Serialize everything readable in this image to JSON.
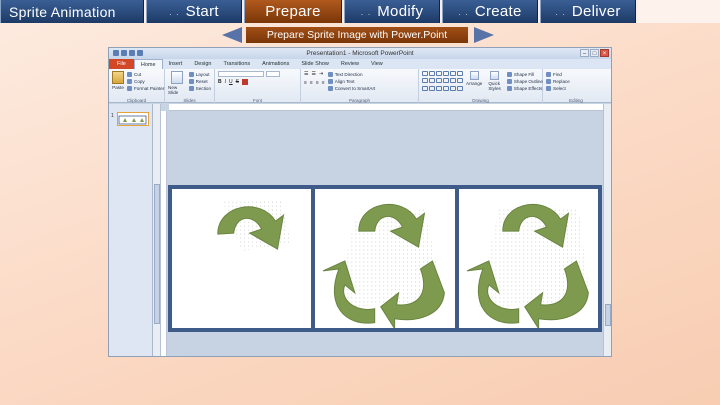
{
  "nav": {
    "brand": "Sprite Animation",
    "dots": ". .",
    "tabs": [
      {
        "label": "Start",
        "active": false
      },
      {
        "label": "Prepare",
        "active": true
      },
      {
        "label": "Modify",
        "active": false
      },
      {
        "label": "Create",
        "active": false
      },
      {
        "label": "Deliver",
        "active": false
      }
    ]
  },
  "substep": {
    "label": "Prepare Sprite Image with Power.Point"
  },
  "colors": {
    "nav_blue": "#1d3a66",
    "active_orange": "#7a3608",
    "arrow_green": "#7e9a4e",
    "frame_border": "#3e5b8a"
  },
  "ppt": {
    "title": "Presentation1 - Microsoft PowerPoint",
    "win_min": "–",
    "win_max": "□",
    "win_close": "×",
    "tabs": [
      "File",
      "Home",
      "Insert",
      "Design",
      "Transitions",
      "Animations",
      "Slide Show",
      "Review",
      "View"
    ],
    "clipboard": {
      "paste": "Paste",
      "cut": "Cut",
      "copy": "Copy",
      "format_painter": "Format Painter",
      "group": "Clipboard"
    },
    "slides": {
      "new_slide": "New Slide",
      "layout": "Layout",
      "reset": "Reset",
      "section": "Section",
      "group": "Slides"
    },
    "font": {
      "bold": "B",
      "italic": "I",
      "underline": "U",
      "strike": "S",
      "group": "Font"
    },
    "paragraph": {
      "text_direction": "Text Direction",
      "align_text": "Align Text",
      "smartart": "Convert to SmartArt",
      "group": "Paragraph"
    },
    "drawing": {
      "arrange": "Arrange",
      "quick_styles": "Quick Styles",
      "shape_fill": "Shape Fill",
      "shape_outline": "Shape Outline",
      "shape_effects": "Shape Effects",
      "group": "Drawing"
    },
    "editing": {
      "find": "Find",
      "replace": "Replace",
      "select": "Select",
      "group": "Editing"
    },
    "slide_number": "1"
  }
}
